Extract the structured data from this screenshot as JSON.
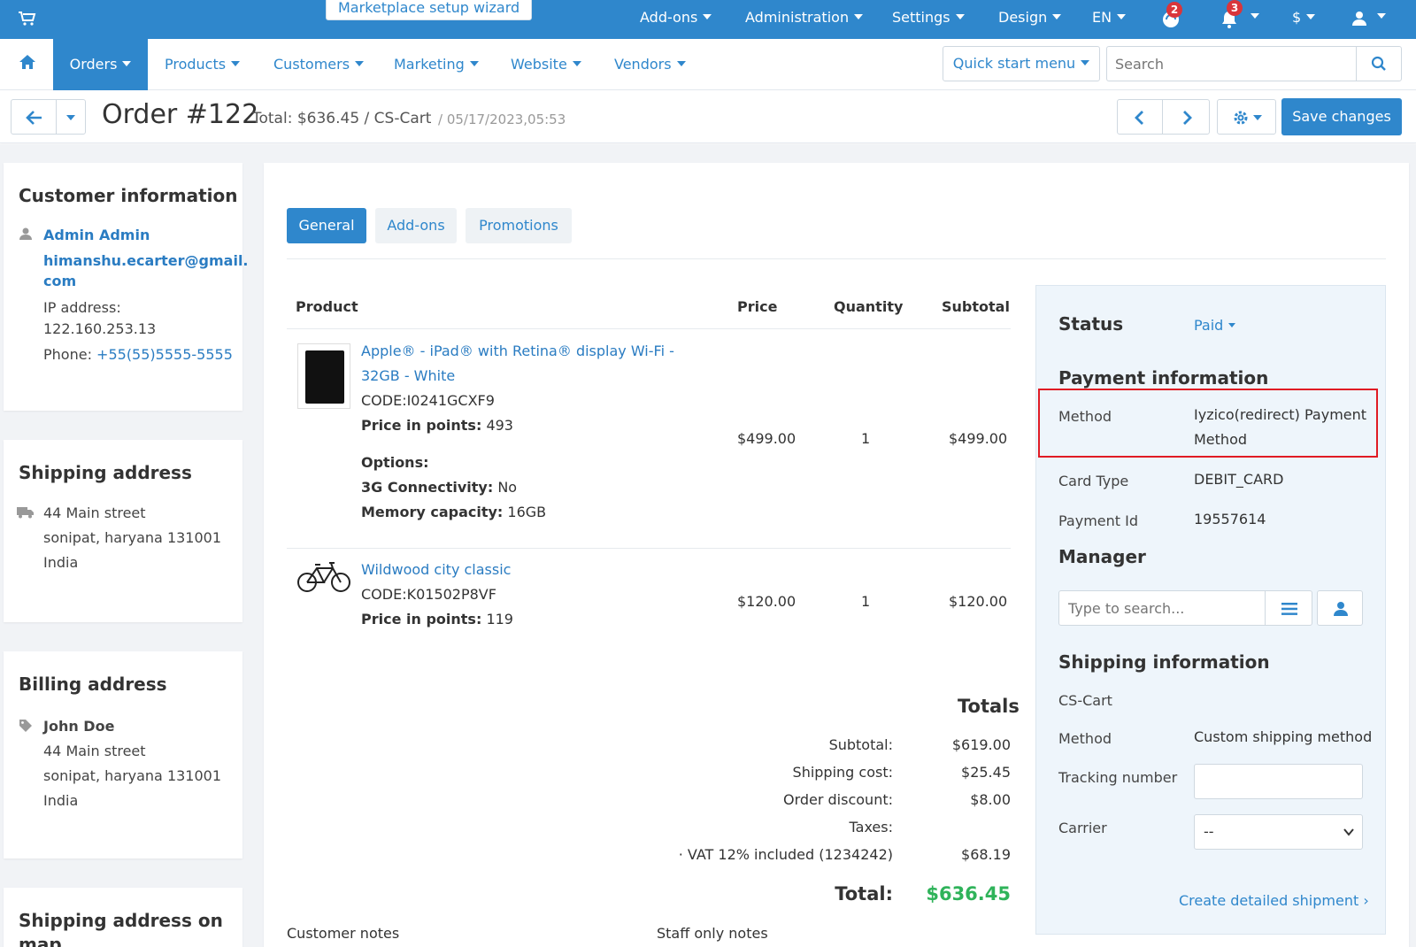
{
  "topbar": {
    "wizard_label": "Marketplace setup wizard",
    "menus": [
      "Add-ons",
      "Administration",
      "Settings",
      "Design",
      "EN"
    ],
    "support_badge": "2",
    "notifications_badge": "3",
    "currency": "$"
  },
  "mainnav": {
    "items": [
      "Orders",
      "Products",
      "Customers",
      "Marketing",
      "Website",
      "Vendors"
    ],
    "quick_start": "Quick start menu",
    "search_placeholder": "Search"
  },
  "toolbar": {
    "title": "Order #122",
    "subtitle": "Total: $636.45 / CS-Cart",
    "date": "/ 05/17/2023,05:53",
    "save_label": "Save changes"
  },
  "customer": {
    "heading": "Customer information",
    "name": "Admin Admin",
    "email_line1": "himanshu.ecarter@gmail.",
    "email_line2": "com",
    "ip_label": "IP address:",
    "ip": "122.160.253.13",
    "phone_label": "Phone:",
    "phone": "+55(55)5555-5555"
  },
  "shipping_address": {
    "heading": "Shipping address",
    "street": "44 Main street",
    "city": "sonipat, haryana 131001",
    "country": "India"
  },
  "billing_address": {
    "heading": "Billing address",
    "name": "John Doe",
    "street": "44 Main street",
    "city": "sonipat, haryana 131001",
    "country": "India"
  },
  "map_card": {
    "heading_line1": "Shipping address on",
    "heading_line2": "map"
  },
  "tabs": [
    "General",
    "Add-ons",
    "Promotions"
  ],
  "products_table": {
    "headers": [
      "Product",
      "Price",
      "Quantity",
      "Subtotal"
    ],
    "rows": [
      {
        "name_line1": "Apple® - iPad® with Retina® display Wi-Fi -",
        "name_line2": "32GB - White",
        "code": "CODE:I0241GCXF9",
        "points_label": "Price in points:",
        "points": "493",
        "options_label": "Options:",
        "opt1_label": "3G Connectivity:",
        "opt1_value": "No",
        "opt2_label": "Memory capacity:",
        "opt2_value": "16GB",
        "price": "$499.00",
        "qty": "1",
        "subtotal": "$499.00"
      },
      {
        "name_line1": "Wildwood city classic",
        "code": "CODE:K01502P8VF",
        "points_label": "Price in points:",
        "points": "119",
        "price": "$120.00",
        "qty": "1",
        "subtotal": "$120.00"
      }
    ]
  },
  "totals": {
    "heading": "Totals",
    "subtotal_label": "Subtotal:",
    "subtotal": "$619.00",
    "shipping_label": "Shipping cost:",
    "shipping": "$25.45",
    "discount_label": "Order discount:",
    "discount": "$8.00",
    "taxes_label": "Taxes:",
    "vat_label": "· VAT 12% included (1234242)",
    "vat": "$68.19",
    "total_label": "Total:",
    "total": "$636.45",
    "total_color": "#2fb35a"
  },
  "notes": {
    "customer_label": "Customer notes",
    "staff_label": "Staff only notes"
  },
  "status_panel": {
    "status_label": "Status",
    "status_value": "Paid",
    "payment_heading": "Payment information",
    "method_label": "Method",
    "method_value_line1": "Iyzico(redirect) Payment",
    "method_value_line2": "Method",
    "card_type_label": "Card Type",
    "card_type": "DEBIT_CARD",
    "payment_id_label": "Payment Id",
    "payment_id": "19557614",
    "manager_heading": "Manager",
    "manager_placeholder": "Type to search...",
    "shipping_heading": "Shipping information",
    "carrier_name": "CS-Cart",
    "ship_method_label": "Method",
    "ship_method": "Custom shipping method",
    "tracking_label": "Tracking number",
    "carrier_label": "Carrier",
    "carrier_value": "--",
    "create_shipment": "Create detailed shipment ›"
  },
  "colors": {
    "brand": "#2f87cc",
    "highlight": "#e01b24"
  }
}
